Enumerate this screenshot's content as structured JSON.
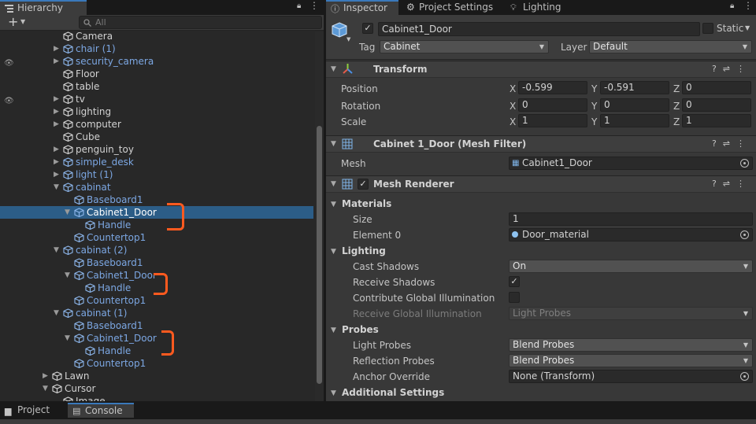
{
  "hierarchy": {
    "tab_label": "Hierarchy",
    "add_label": "+",
    "search_placeholder": "All",
    "items": [
      {
        "label": "Camera",
        "color": "white"
      },
      {
        "label": "chair (1)",
        "color": "blue"
      },
      {
        "label": "security_camera",
        "color": "blue"
      },
      {
        "label": "Floor",
        "color": "white"
      },
      {
        "label": "table",
        "color": "white"
      },
      {
        "label": "tv",
        "color": "white"
      },
      {
        "label": "lighting",
        "color": "white"
      },
      {
        "label": "computer",
        "color": "white"
      },
      {
        "label": "Cube",
        "color": "white"
      },
      {
        "label": "penguin_toy",
        "color": "white"
      },
      {
        "label": "simple_desk",
        "color": "blue"
      },
      {
        "label": "light (1)",
        "color": "blue"
      },
      {
        "label": "cabinat",
        "color": "blue"
      },
      {
        "label": "Baseboard1",
        "color": "blue"
      },
      {
        "label": "Cabinet1_Door",
        "color": "selected"
      },
      {
        "label": "Handle",
        "color": "blue"
      },
      {
        "label": "Countertop1",
        "color": "blue"
      },
      {
        "label": "cabinat (2)",
        "color": "blue"
      },
      {
        "label": "Baseboard1",
        "color": "blue"
      },
      {
        "label": "Cabinet1_Door",
        "color": "blue"
      },
      {
        "label": "Handle",
        "color": "blue"
      },
      {
        "label": "Countertop1",
        "color": "blue"
      },
      {
        "label": "cabinat (1)",
        "color": "blue"
      },
      {
        "label": "Baseboard1",
        "color": "blue"
      },
      {
        "label": "Cabinet1_Door",
        "color": "blue"
      },
      {
        "label": "Handle",
        "color": "blue"
      },
      {
        "label": "Countertop1",
        "color": "blue"
      },
      {
        "label": "Lawn",
        "color": "white"
      },
      {
        "label": "Cursor",
        "color": "white"
      },
      {
        "label": "Image",
        "color": "white"
      }
    ]
  },
  "inspector": {
    "tabs": [
      "Inspector",
      "Project Settings",
      "Lighting"
    ],
    "object_name": "Cabinet1_Door",
    "static_label": "Static",
    "tag_label": "Tag",
    "tag_value": "Cabinet",
    "layer_label": "Layer",
    "layer_value": "Default",
    "transform": {
      "title": "Transform",
      "position_label": "Position",
      "rotation_label": "Rotation",
      "scale_label": "Scale",
      "position": {
        "x": "-0.599",
        "y": "-0.591",
        "z": "0"
      },
      "rotation": {
        "x": "0",
        "y": "0",
        "z": "0"
      },
      "scale": {
        "x": "1",
        "y": "1",
        "z": "1"
      },
      "x_label": "X",
      "y_label": "Y",
      "z_label": "Z"
    },
    "mesh_filter": {
      "title": "Cabinet 1_Door (Mesh Filter)",
      "mesh_label": "Mesh",
      "mesh_value": "Cabinet1_Door"
    },
    "mesh_renderer": {
      "title": "Mesh Renderer",
      "materials_label": "Materials",
      "size_label": "Size",
      "size_value": "1",
      "element0_label": "Element 0",
      "element0_value": "Door_material",
      "lighting_label": "Lighting",
      "cast_shadows_label": "Cast Shadows",
      "cast_shadows_value": "On",
      "receive_shadows_label": "Receive Shadows",
      "contribute_gi_label": "Contribute Global Illumination",
      "receive_gi_label": "Receive Global Illumination",
      "receive_gi_value": "Light Probes",
      "probes_label": "Probes",
      "light_probes_label": "Light Probes",
      "light_probes_value": "Blend Probes",
      "reflection_probes_label": "Reflection Probes",
      "reflection_probes_value": "Blend Probes",
      "anchor_override_label": "Anchor Override",
      "anchor_override_value": "None (Transform)",
      "additional_settings_label": "Additional Settings"
    }
  },
  "bottom": {
    "tabs": [
      "Project",
      "Console"
    ]
  },
  "colors": {
    "selection": "#2c5d87",
    "prefab_blue": "#7ca7e3",
    "annotation": "#ff5a1f"
  }
}
